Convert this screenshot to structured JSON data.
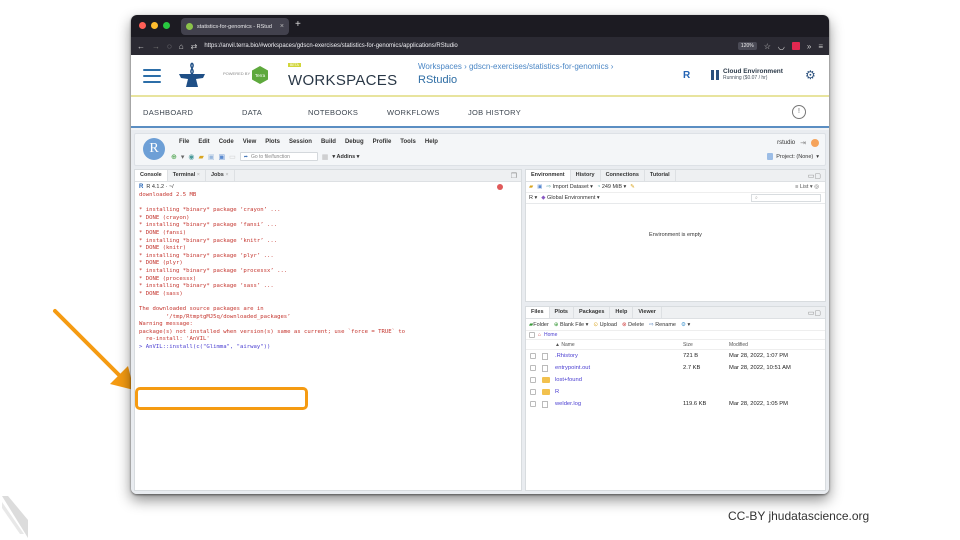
{
  "browser": {
    "tab_title": "statistics-for-genomics - RStud",
    "url": "https://anvil.terra.bio/#workspaces/gdscn-exercises/statistics-for-genomics/applications/RStudio",
    "zoom": "120%"
  },
  "anvil": {
    "powered_by": "POWERED BY",
    "terra_label": "Terra",
    "beta": "BETA",
    "title": "WORKSPACES",
    "breadcrumb": "Workspaces › gdscn-exercises/statistics-for-genomics ›",
    "current": "RStudio",
    "cloud_env_title": "Cloud Environment",
    "cloud_env_status": "Running ($0.07 / hr)",
    "nav": [
      "DASHBOARD",
      "DATA",
      "NOTEBOOKS",
      "WORKFLOWS",
      "JOB HISTORY"
    ]
  },
  "rstudio": {
    "menu": [
      "File",
      "Edit",
      "Code",
      "View",
      "Plots",
      "Session",
      "Build",
      "Debug",
      "Profile",
      "Tools",
      "Help"
    ],
    "goto_placeholder": "Go to file/function",
    "addins": "Addins",
    "user": "rstudio",
    "project": "Project: (None)",
    "console_tabs": [
      "Console",
      "Terminal",
      "Jobs"
    ],
    "r_version": "R 4.1.2 · ~/",
    "console_lines": [
      "downloaded 2.5 MB",
      "",
      "* installing *binary* package ‘crayon’ ...",
      "* DONE (crayon)",
      "* installing *binary* package ‘fansi’ ...",
      "* DONE (fansi)",
      "* installing *binary* package ‘knitr’ ...",
      "* DONE (knitr)",
      "* installing *binary* package ‘plyr’ ...",
      "* DONE (plyr)",
      "* installing *binary* package ‘processx’ ...",
      "* DONE (processx)",
      "* installing *binary* package ‘sass’ ...",
      "* DONE (sass)",
      "",
      "The downloaded source packages are in",
      "        ‘/tmp/RtmptgMJ5q/downloaded_packages’",
      "Warning message:",
      "package(s) not installed when version(s) same as current; use `force = TRUE` to",
      "  re-install: 'AnVIL'"
    ],
    "console_command": "> AnVIL::install(c(\"Glimma\", \"airway\"))",
    "env_tabs": [
      "Environment",
      "History",
      "Connections",
      "Tutorial"
    ],
    "import_dataset": "Import Dataset",
    "memory": "249 MiB",
    "list_label": "List",
    "r_selector": "R",
    "global_env": "Global Environment",
    "env_empty": "Environment is empty",
    "files_tabs": [
      "Files",
      "Plots",
      "Packages",
      "Help",
      "Viewer"
    ],
    "files_toolbar": [
      "Folder",
      "Blank File",
      "Upload",
      "Delete",
      "Rename"
    ],
    "home": "Home",
    "files_headers": [
      "▲ Name",
      "Size",
      "Modified"
    ],
    "files": [
      {
        "name": ".Rhistory",
        "size": "721 B",
        "modified": "Mar 28, 2022, 1:07 PM",
        "type": "file"
      },
      {
        "name": "entrypoint.out",
        "size": "2.7 KB",
        "modified": "Mar 28, 2022, 10:51 AM",
        "type": "file"
      },
      {
        "name": "lost+found",
        "size": "",
        "modified": "",
        "type": "folder"
      },
      {
        "name": "R",
        "size": "",
        "modified": "",
        "type": "folder"
      },
      {
        "name": "welder.log",
        "size": "119.6 KB",
        "modified": "Mar 28, 2022, 1:05 PM",
        "type": "file"
      }
    ]
  },
  "footer": "CC-BY jhudatascience.org",
  "colors": {
    "highlight": "#f59b12",
    "console_text": "#c4342d",
    "command": "#4b3fd1"
  }
}
